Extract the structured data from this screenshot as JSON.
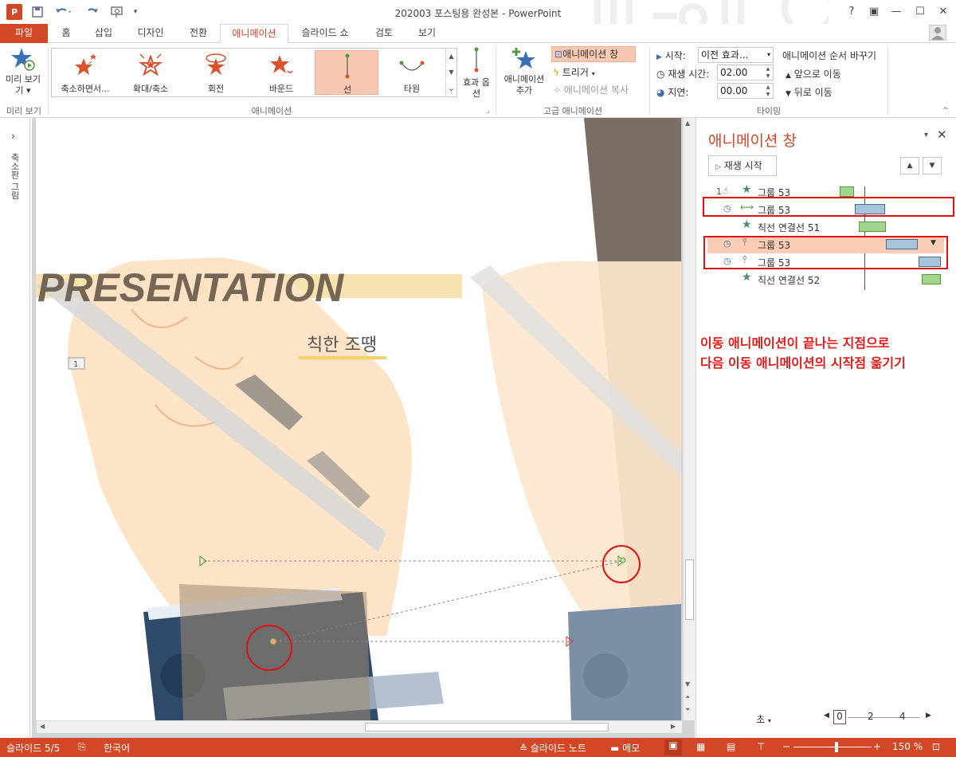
{
  "app": {
    "logo": "P",
    "title": "202003 포스팅용 완성본 - PowerPoint"
  },
  "window": {
    "help": "?",
    "restore_ribbon": "▣",
    "minimize": "—",
    "maximize": "☐",
    "close": "✕"
  },
  "tabs": [
    "파일",
    "홈",
    "삽입",
    "디자인",
    "전환",
    "애니메이션",
    "슬라이드 쇼",
    "검토",
    "보기"
  ],
  "ribbon": {
    "preview": {
      "label": "미리 보기",
      "dropdown": "기 ▾",
      "group": "미리 보기"
    },
    "animations": {
      "items": [
        "축소하면서...",
        "확대/축소",
        "회전",
        "바운드",
        "선",
        "타원"
      ],
      "selected": "선",
      "effect_options": "효과 옵션",
      "group": "애니메이션",
      "more": "⌄"
    },
    "advanced": {
      "add_animation": "애니메이션 추가",
      "pane": "애니메이션 창",
      "trigger": "트리거",
      "painter": "애니메이션 복사",
      "group": "고급 애니메이션"
    },
    "timing": {
      "start_label": "시작:",
      "start_value": "이전 효과...",
      "duration_label": "재생 시간:",
      "duration_value": "02.00",
      "delay_label": "지연:",
      "delay_value": "00.00",
      "reorder": "애니메이션 순서 바꾸기",
      "move_earlier": "앞으로 이동",
      "move_later": "뒤로 이동",
      "group": "타이밍"
    }
  },
  "thumbnails": {
    "label": "축소판 그림",
    "expand": "›"
  },
  "slide": {
    "title_text": "PRESENTATION",
    "subtitle_text": "칙한 조땡",
    "marker": "1"
  },
  "anim_pane": {
    "title": "애니메이션 창",
    "play": "재생 시작",
    "rows": [
      {
        "num": "1",
        "name": "그룹 53",
        "icon": "star-icon",
        "bar": "green"
      },
      {
        "num": "",
        "name": "그룹 53",
        "icon": "line-motion-icon",
        "bar": "blue"
      },
      {
        "num": "",
        "name": "직선 연결선 51",
        "icon": "star-icon",
        "bar": "green"
      },
      {
        "num": "",
        "name": "그룹 53",
        "icon": "vertical-motion-icon",
        "bar": "blue"
      },
      {
        "num": "",
        "name": "그룹 53",
        "icon": "vertical-motion-icon",
        "bar": "blue"
      },
      {
        "num": "",
        "name": "직선 연결선 52",
        "icon": "star-icon",
        "bar": "green"
      }
    ],
    "annotation_line1": "이동 애니메이션이 끝나는 지점으로",
    "annotation_line2": "다음 이동 애니메이션의 시작점 옮기기",
    "seconds": "초",
    "scale": [
      "0",
      "2",
      "4"
    ]
  },
  "status": {
    "slide_info": "슬라이드 5/5",
    "language": "한국어",
    "notes": "슬라이드 노트",
    "comments": "메모",
    "zoom": "150 %",
    "minus": "−",
    "plus": "+"
  },
  "colors": {
    "accent": "#d24726",
    "annotation": "#e31b1b",
    "bar_green": "#a3d48c",
    "bar_blue": "#a7c4db",
    "selection": "#fbcdb5"
  }
}
